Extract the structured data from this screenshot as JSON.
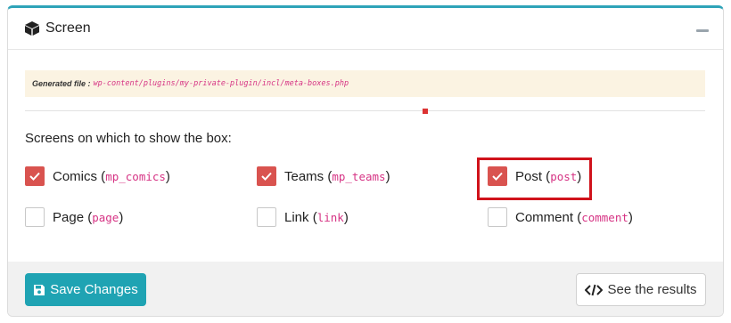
{
  "panel": {
    "title": "Screen",
    "icon": "cube-icon"
  },
  "notice": {
    "label": "Generated file :",
    "path": "wp-content/plugins/my-private-plugin/incl/meta-boxes.php"
  },
  "screens": {
    "label": "Screens on which to show the box:",
    "options": [
      {
        "name": "Comics",
        "slug": "mp_comics",
        "checked": true
      },
      {
        "name": "Teams",
        "slug": "mp_teams",
        "checked": true
      },
      {
        "name": "Post",
        "slug": "post",
        "checked": true
      },
      {
        "name": "Page",
        "slug": "page",
        "checked": false
      },
      {
        "name": "Link",
        "slug": "link",
        "checked": false
      },
      {
        "name": "Comment",
        "slug": "comment",
        "checked": false
      }
    ]
  },
  "footer": {
    "save_label": "Save Changes",
    "results_label": "See the results"
  },
  "colors": {
    "accent": "#2ea3b8",
    "checked": "#d9534f",
    "highlight": "#d0121b"
  }
}
